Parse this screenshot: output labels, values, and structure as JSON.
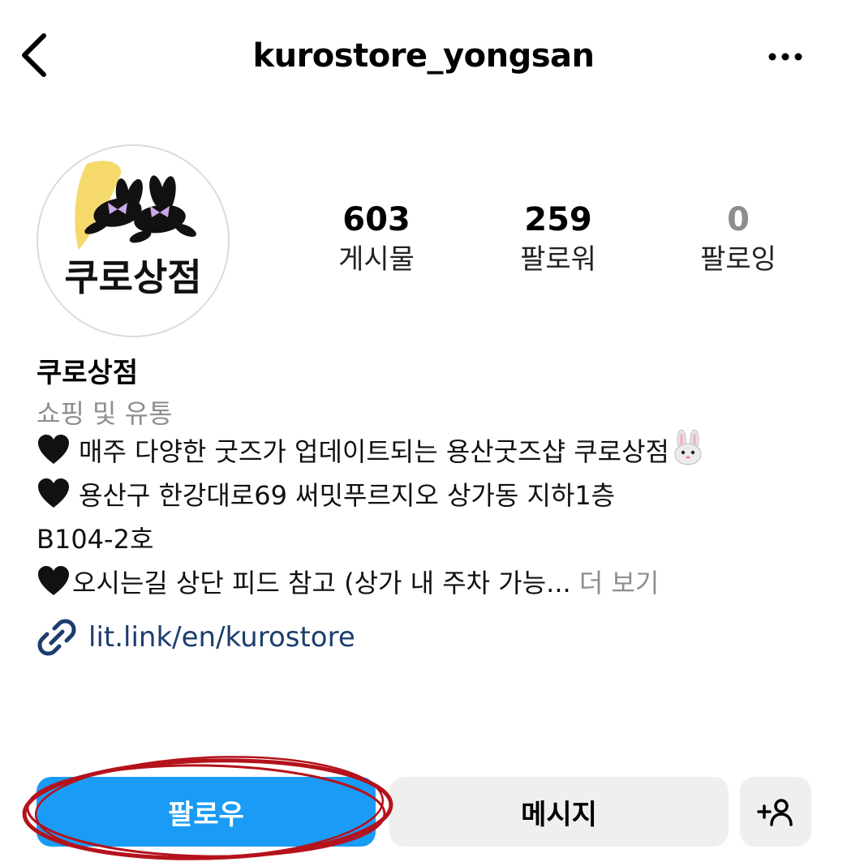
{
  "header": {
    "username": "kurostore_yongsan",
    "back_icon": "chevron-left-icon",
    "more_icon": "more-horizontal-icon"
  },
  "profile": {
    "avatar_text": "쿠로상점",
    "stats": [
      {
        "value": "603",
        "label": "게시물"
      },
      {
        "value": "259",
        "label": "팔로워"
      },
      {
        "value": "0",
        "label": "팔로잉"
      }
    ],
    "display_name": "쿠로상점",
    "category": "쇼핑 및 유통",
    "bio": {
      "line1": "매주 다양한 굿즈가 업데이트되는 용산굿즈샵 쿠로상점",
      "line2": "용산구 한강대로69 써밋푸르지오 상가동 지하1층",
      "line3": "B104-2호",
      "line4": "오시는길 상단 피드 참고 (상가 내 주차 가능...",
      "more": "더 보기"
    },
    "link": "lit.link/en/kurostore"
  },
  "actions": {
    "follow": "팔로우",
    "message": "메시지",
    "add_user_icon": "add-person-icon"
  },
  "colors": {
    "follow_button": "#1a9bf5",
    "secondary_button": "#efefef",
    "link": "#1c3d6e",
    "muted": "#8e8e8e",
    "annotation": "#b5121b"
  }
}
